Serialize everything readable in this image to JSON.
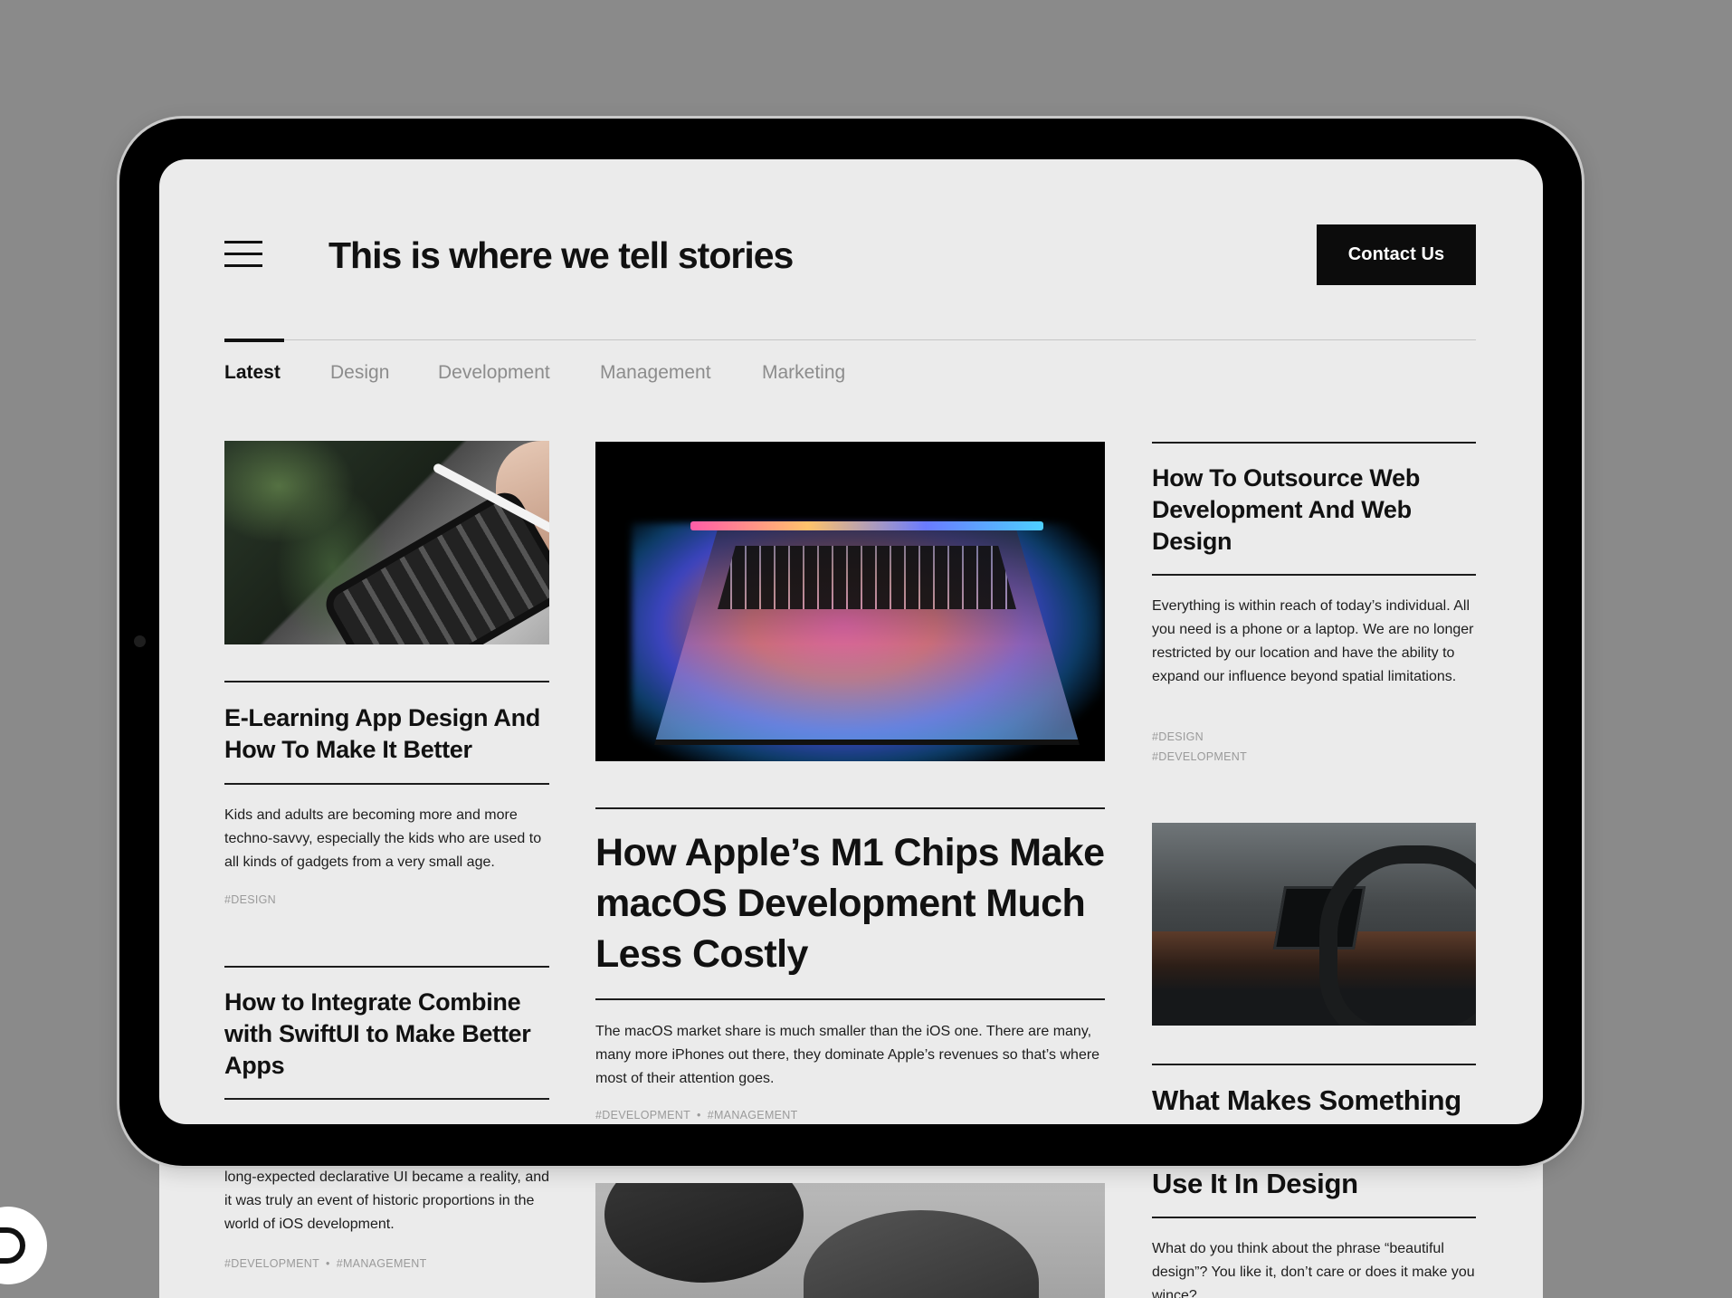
{
  "header": {
    "site_title": "This is where we tell stories",
    "contact_label": "Contact Us"
  },
  "tabs": [
    {
      "label": "Latest",
      "active": true
    },
    {
      "label": "Design",
      "active": false
    },
    {
      "label": "Development",
      "active": false
    },
    {
      "label": "Management",
      "active": false
    },
    {
      "label": "Marketing",
      "active": false
    }
  ],
  "articles": {
    "elearning": {
      "title": "E-Learning App Design And How To Make It Better",
      "excerpt": "Kids and adults are becoming more and more techno-savvy, especially the kids who are used to all kinds of gadgets from a very small age.",
      "tags": [
        "#DESIGN"
      ]
    },
    "combine": {
      "title": "How to Integrate Combine with SwiftUI to Make Better Apps",
      "excerpt": "long-expected declarative UI became a reality, and it was truly an event of historic proportions in the world of iOS development.",
      "tags": [
        "#DEVELOPMENT",
        "#MANAGEMENT"
      ]
    },
    "m1": {
      "title": "How Apple’s M1 Chips Make macOS Development Much Less Costly",
      "excerpt": "The macOS market share is much smaller than the iOS one. There are many, many more iPhones out there, they dominate Apple’s revenues so that’s where most of their attention goes.",
      "tags": [
        "#DEVELOPMENT",
        "#MANAGEMENT"
      ]
    },
    "outsource": {
      "title": "How To Outsource Web Development And Web Design",
      "excerpt": "Everything is within reach of today’s individual. All you need is a phone or a laptop. We are no longer restricted by our location and have the ability to expand our influence beyond spatial limitations.",
      "tags": [
        "#DESIGN",
        "#DEVELOPMENT"
      ]
    },
    "beautiful": {
      "title_visible": "What Makes Something",
      "title_below": "Use It In Design",
      "excerpt": "What do you think about the phrase “beautiful design”? You like it, don’t care or does it make you wince?"
    }
  },
  "colors": {
    "page_bg": "#ebebeb",
    "frame": "#000000",
    "backdrop": "#8a8a8a",
    "text": "#111111",
    "muted": "#9a9a9a",
    "button": "#0c0c0c"
  },
  "icons": {
    "menu": "hamburger-menu-icon",
    "camera": "front-camera-icon",
    "badge": "logo-badge-icon"
  }
}
